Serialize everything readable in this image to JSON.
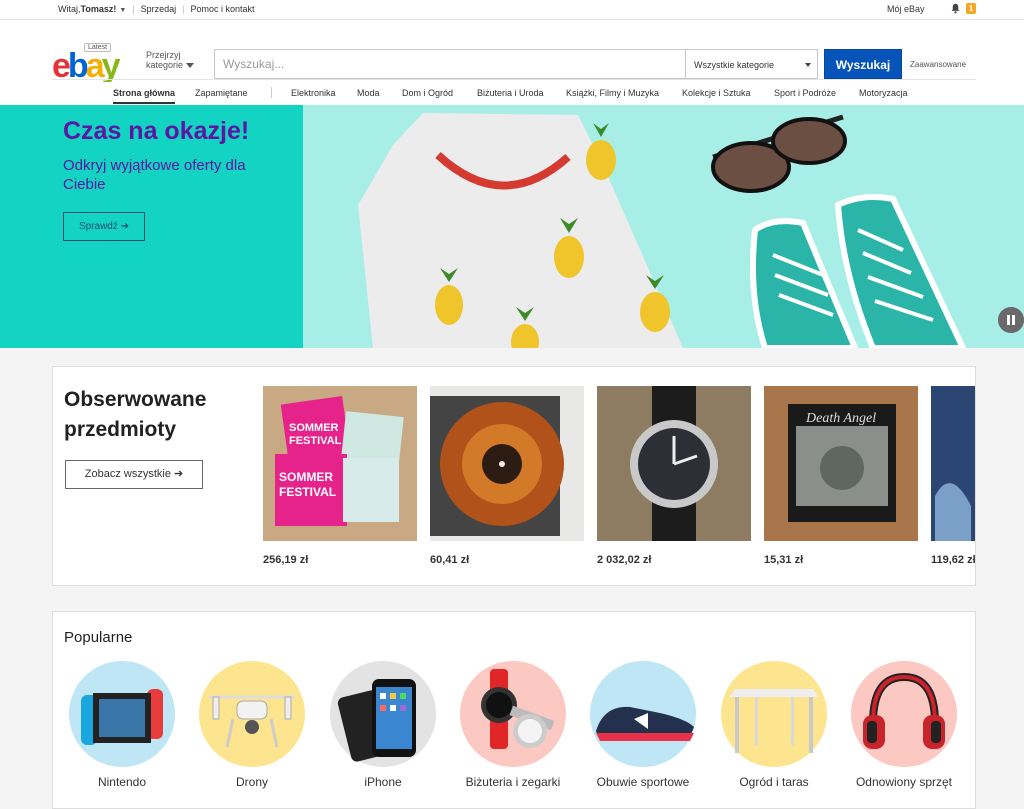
{
  "topbar": {
    "greeting_prefix": "Witaj, ",
    "user_name": "Tomasz!",
    "sell": "Sprzedaj",
    "help": "Pomoc i kontakt",
    "my_ebay": "Mój eBay",
    "notifications": "1"
  },
  "header": {
    "logo_badge": "Latest",
    "categories_btn": [
      "Przejrzyj",
      "kategorie"
    ],
    "search_placeholder": "Wyszukaj...",
    "category_select": "Wszystkie kategorie",
    "search_button": "Wyszukaj",
    "advanced": "Zaawansowane"
  },
  "nav": {
    "items": [
      "Strona główna",
      "Zapamiętane",
      "Elektronika",
      "Moda",
      "Dom i Ogród",
      "Biżuteria i Uroda",
      "Książki, Filmy i Muzyka",
      "Kolekcje i Sztuka",
      "Sport i Podróże",
      "Motoryzacja"
    ]
  },
  "hero": {
    "title": "Czas na okazje!",
    "subtitle": "Odkryj wyjątkowe oferty dla Ciebie",
    "cta": "Sprawdź ➔"
  },
  "watched": {
    "title": "Obserwowane przedmioty",
    "see_all": "Zobacz wszystkie ➔",
    "items": [
      {
        "price": "256,19 zł",
        "thumb_icon": "festival-ticket"
      },
      {
        "price": "60,41 zł",
        "thumb_icon": "vinyl-record"
      },
      {
        "price": "2 032,02 zł",
        "thumb_icon": "wristwatch"
      },
      {
        "price": "15,31 zł",
        "thumb_icon": "album-cover"
      },
      {
        "price": "119,62 zł",
        "thumb_icon": "poster"
      }
    ]
  },
  "popular": {
    "title": "Popularne",
    "items": [
      {
        "label": "Nintendo",
        "color": "#bfe6f5",
        "icon": "console"
      },
      {
        "label": "Drony",
        "color": "#fde58f",
        "icon": "drone"
      },
      {
        "label": "iPhone",
        "color": "#e3e3e3",
        "icon": "smartphone"
      },
      {
        "label": "Biżuteria i zegarki",
        "color": "#fbc9c2",
        "icon": "watch"
      },
      {
        "label": "Obuwie sportowe",
        "color": "#bfe6f5",
        "icon": "sneaker"
      },
      {
        "label": "Ogród i taras",
        "color": "#fde58f",
        "icon": "gazebo"
      },
      {
        "label": "Odnowiony sprzęt",
        "color": "#fbc9c2",
        "icon": "headphones"
      }
    ]
  },
  "colors": {
    "brand_blue": "#0654ba",
    "hero_teal": "#13d4c2",
    "hero_purple": "#5b16a3"
  }
}
